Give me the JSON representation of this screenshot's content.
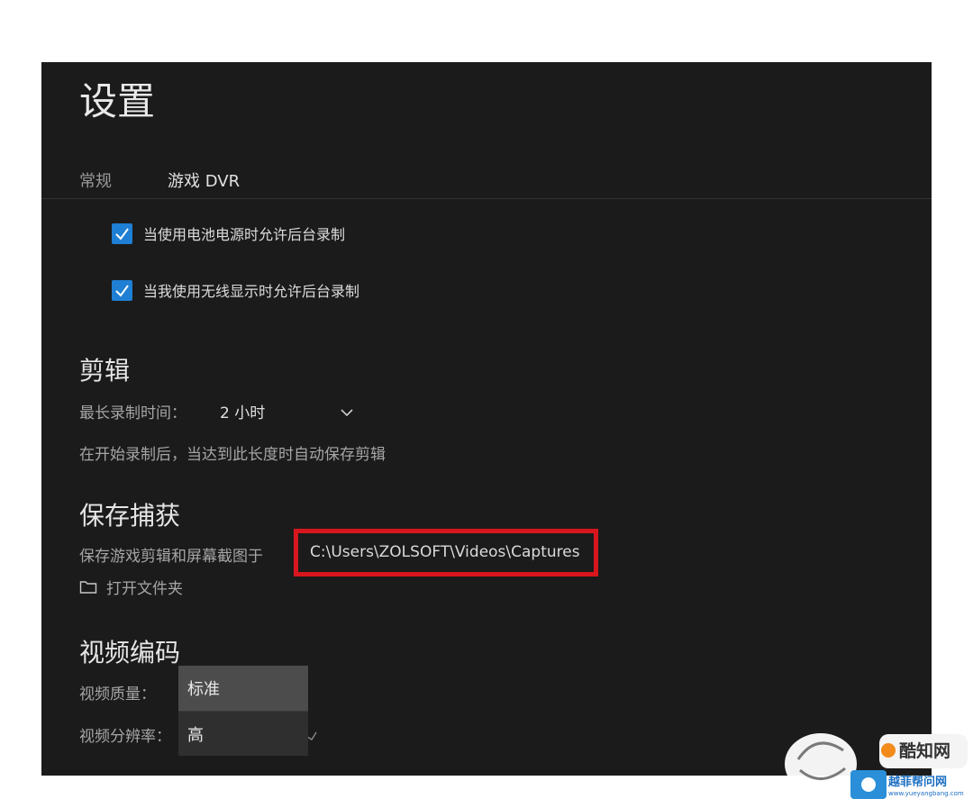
{
  "window": {
    "title": "设置"
  },
  "tabs": [
    {
      "label": "常规"
    },
    {
      "label": "游戏 DVR"
    }
  ],
  "background_recording": {
    "battery": {
      "label": "当使用电池电源时允许后台录制",
      "checked": true
    },
    "wireless": {
      "label": "当我使用无线显示时允许后台录制",
      "checked": true
    }
  },
  "clips": {
    "heading": "剪辑",
    "max_length_label": "最长录制时间：",
    "max_length_value": "2 小时",
    "description": "在开始录制后，当达到此长度时自动保存剪辑"
  },
  "save_captures": {
    "heading": "保存捕获",
    "label": "保存游戏剪辑和屏幕截图于",
    "path": "C:\\Users\\ZOLSOFT\\Videos\\Captures",
    "open_folder": "打开文件夹"
  },
  "video_encoding": {
    "heading": "视频编码",
    "quality_label": "视频质量：",
    "resolution_label": "视频分辨率：",
    "dropdown_options": [
      "标准",
      "高"
    ]
  },
  "watermark": {
    "primary": "酷知网",
    "secondary": "越菲帮问网",
    "url": "www.yueyangbang.com"
  },
  "colors": {
    "panel_bg": "#1b1b1b",
    "checkbox_accent": "#1f7fd4",
    "highlight_box": "#d8161d"
  }
}
